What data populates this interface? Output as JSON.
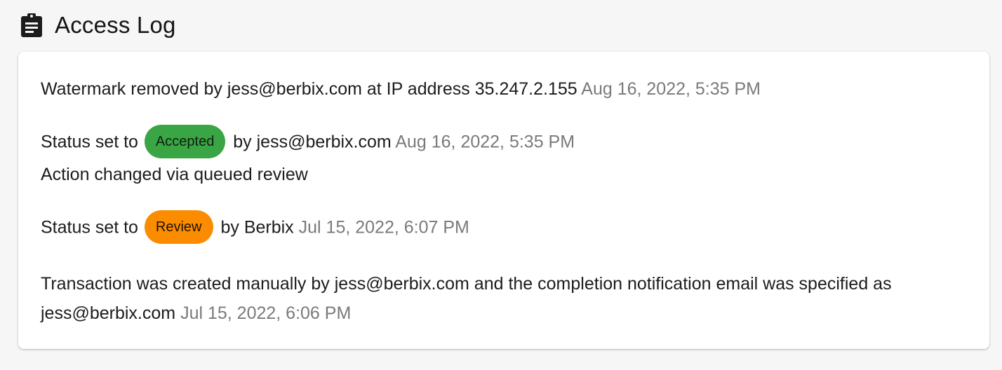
{
  "header": {
    "icon": "clipboard-icon",
    "title": "Access Log"
  },
  "colors": {
    "accepted_badge": "#3aa544",
    "review_badge": "#fb8c00",
    "timestamp": "#7a7a7a"
  },
  "log": {
    "entry1": {
      "prefix": "Watermark removed by",
      "user": "jess@berbix.com",
      "middle": "at IP address",
      "ip": "35.247.2.155",
      "timestamp": "Aug 16, 2022, 5:35 PM"
    },
    "entry2": {
      "prefix": "Status set to",
      "badge": "Accepted",
      "by": "by",
      "user": "jess@berbix.com",
      "timestamp": "Aug 16, 2022, 5:35 PM",
      "note": "Action changed via queued review"
    },
    "entry3": {
      "prefix": "Status set to",
      "badge": "Review",
      "by": "by",
      "user": "Berbix",
      "timestamp": "Jul 15, 2022, 6:07 PM"
    },
    "entry4": {
      "prefix": "Transaction was created manually by",
      "user": "jess@berbix.com",
      "middle": "and the completion notification email was specified as",
      "email": "jess@berbix.com",
      "timestamp": "Jul 15, 2022, 6:06 PM"
    }
  }
}
